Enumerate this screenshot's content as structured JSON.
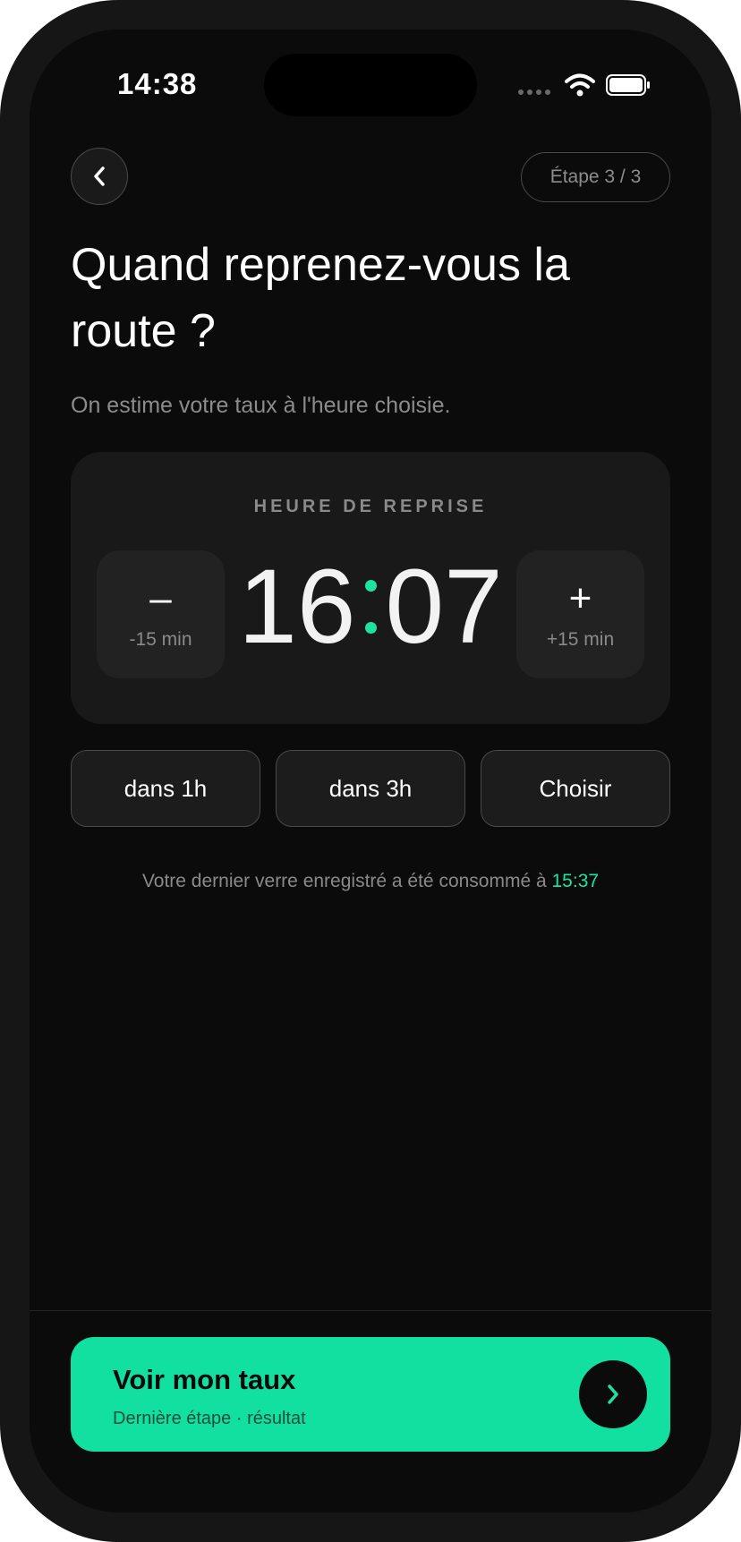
{
  "status_bar": {
    "time": "14:38"
  },
  "header": {
    "step_label": "Étape 3 / 3"
  },
  "title": "Quand reprenez-vous la route ?",
  "subtitle": "On estime votre taux à l'heure choisie.",
  "time_card": {
    "label": "HEURE DE REPRISE",
    "hours": "16",
    "minutes": "07",
    "decrement": {
      "symbol": "–",
      "label": "-15 min"
    },
    "increment": {
      "symbol": "+",
      "label": "+15 min"
    }
  },
  "quick_options": [
    "dans 1h",
    "dans 3h",
    "Choisir"
  ],
  "last_drink": {
    "text": "Votre dernier verre enregistré a été consommé à ",
    "time": "15:37"
  },
  "cta": {
    "title": "Voir mon taux",
    "subtitle": "Dernière étape · résultat"
  },
  "colors": {
    "accent": "#1ee3a0",
    "cta_bg": "#12e0a0",
    "background": "#0b0b0b"
  },
  "icons": {
    "back": "chevron-left-icon",
    "cta": "chevron-right-icon",
    "wifi": "wifi-icon",
    "battery": "battery-icon"
  }
}
